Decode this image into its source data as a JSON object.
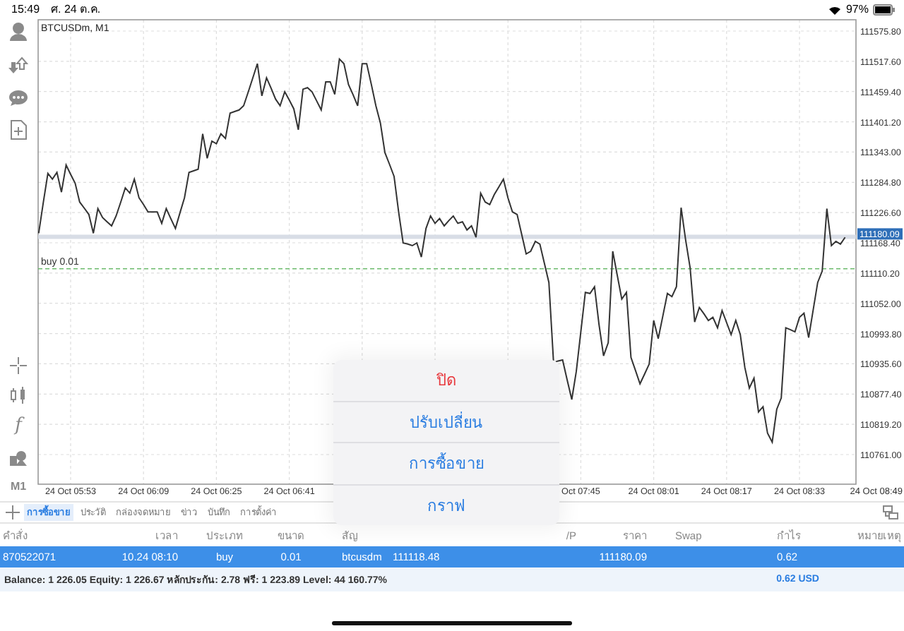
{
  "status_bar": {
    "time": "15:49",
    "date": "ศ. 24 ต.ค.",
    "battery": "97%"
  },
  "toolbar": {
    "timeframe": "M1",
    "indicator_button": "f"
  },
  "chart": {
    "title": "BTCUSDm, M1",
    "chart_data": {
      "type": "line",
      "ylim": [
        110704,
        111597.5
      ],
      "categories": [
        null,
        null,
        null,
        null,
        null,
        null,
        null,
        "24 Oct 05:53",
        null,
        null,
        null,
        null,
        null,
        null,
        null,
        null,
        null,
        null,
        null,
        null,
        null,
        null,
        null,
        "24 Oct 06:09",
        null,
        null,
        null,
        null,
        null,
        null,
        null,
        null,
        null,
        null,
        null,
        null,
        null,
        null,
        null,
        "24 Oct 06:25",
        null,
        null,
        null,
        null,
        null,
        null,
        null,
        null,
        null,
        null,
        null,
        null,
        null,
        null,
        null,
        "24 Oct 06:41",
        null,
        null,
        null,
        null,
        null,
        null,
        null,
        null,
        null,
        null,
        null,
        null,
        null,
        null,
        null,
        null,
        null,
        null,
        null,
        null,
        null,
        null,
        null,
        null,
        null,
        null,
        null,
        null,
        null,
        null,
        null,
        null,
        null,
        null,
        null,
        null,
        null,
        null,
        null,
        null,
        null,
        null,
        null,
        null,
        null,
        null,
        null,
        null,
        null,
        null,
        null,
        null,
        null,
        null,
        null,
        null,
        null,
        null,
        null,
        null,
        null,
        null,
        null,
        "Oct 07:45",
        null,
        null,
        null,
        null,
        null,
        null,
        null,
        null,
        null,
        null,
        null,
        null,
        null,
        null,
        null,
        "24 Oct 08:01",
        null,
        null,
        null,
        null,
        null,
        null,
        null,
        null,
        null,
        null,
        null,
        null,
        null,
        null,
        null,
        "24 Oct 08:17",
        null,
        null,
        null,
        null,
        null,
        null,
        null,
        null,
        null,
        null,
        null,
        null,
        null,
        null,
        null,
        "24 Oct 08:33",
        null,
        null,
        null,
        null,
        null,
        null,
        null,
        null,
        null,
        null
      ],
      "yticks": [
        {
          "value": 111575.8,
          "label": "111575.80"
        },
        {
          "value": 111517.6,
          "label": "111517.60"
        },
        {
          "value": 111459.4,
          "label": "111459.40"
        },
        {
          "value": 111401.2,
          "label": "111401.20"
        },
        {
          "value": 111343,
          "label": "111343.00"
        },
        {
          "value": 111284.8,
          "label": "111284.80"
        },
        {
          "value": 111226.6,
          "label": "111226.60"
        },
        {
          "value": 111168.4,
          "label": "111168.40"
        },
        {
          "value": 111110.2,
          "label": "111110.20"
        },
        {
          "value": 111052,
          "label": "111052.00"
        },
        {
          "value": 110993.8,
          "label": "110993.80"
        },
        {
          "value": 110935.6,
          "label": "110935.60"
        },
        {
          "value": 110877.4,
          "label": "110877.40"
        },
        {
          "value": 110819.2,
          "label": "110819.20"
        },
        {
          "value": 110761,
          "label": "110761.00"
        }
      ],
      "series": [
        {
          "color": "#333333",
          "values": [
            111187,
            111245,
            111302,
            111291,
            111304,
            111266,
            111318,
            111300,
            111283,
            111247,
            111235,
            111223,
            111187,
            111234,
            111217,
            111209,
            111201,
            111220,
            111247,
            111274,
            111264,
            111291,
            111255,
            111242,
            111228,
            111228,
            111228,
            111206,
            111234,
            111215,
            111196,
            111226,
            111255,
            111304,
            111307,
            111310,
            111378,
            111331,
            111364,
            111359,
            111378,
            111369,
            111418,
            111421,
            111424,
            111432,
            111459,
            111486,
            111513,
            111451,
            111486,
            111466,
            111445,
            111432,
            111459,
            111443,
            111426,
            111386,
            111464,
            111467,
            111459,
            111442,
            111424,
            111478,
            111478,
            111454,
            111522,
            111513,
            111473,
            111453,
            111432,
            111513,
            111513,
            111473,
            111432,
            111399,
            111342,
            111319,
            111296,
            111228,
            111168,
            111166,
            111163,
            111168,
            111141,
            111196,
            111220,
            111206,
            111215,
            111201,
            111211,
            111220,
            111206,
            111209,
            111193,
            111201,
            111179,
            111264,
            111247,
            111242,
            111261,
            111276,
            111291,
            111255,
            111228,
            111223,
            111185,
            111147,
            111152,
            111171,
            111166,
            111129,
            111092,
            110938,
            110941,
            110943,
            110905,
            110867,
            110921,
            110997,
            111073,
            111071,
            111084,
            111011,
            110951,
            110976,
            111152,
            111106,
            111060,
            111073,
            110948,
            110923,
            110897,
            110916,
            110935,
            111019,
            110984,
            111028,
            111071,
            111065,
            111084,
            111236,
            111174,
            111120,
            111016,
            111044,
            111032,
            111019,
            111025,
            111005,
            111038,
            111015,
            110992,
            111019,
            110992,
            110929,
            110889,
            110908,
            110843,
            110853,
            110802,
            110785,
            110848,
            110870,
            111005,
            111001,
            110997,
            111025,
            111033,
            110986,
            111039,
            111092,
            111114,
            111234,
            111163,
            111171,
            111166,
            111179
          ]
        }
      ],
      "grid": true,
      "ref_lines": [
        {
          "axis": "y",
          "value": 111118.48,
          "label": "buy 0.01",
          "color": "#6dbb6d"
        },
        {
          "axis": "y",
          "value": 111180.09,
          "label": "111180.09",
          "color": "#d8dde6"
        }
      ]
    },
    "axis_end_label": "24 Oct 08:49"
  },
  "action_sheet": {
    "items": [
      {
        "label": "ปิด",
        "kind": "destructive"
      },
      {
        "label": "ปรับเปลี่ยน",
        "kind": "default"
      },
      {
        "label": "การซื้อขาย",
        "kind": "default"
      },
      {
        "label": "กราฟ",
        "kind": "default"
      }
    ]
  },
  "tabs": [
    {
      "label": "การซื้อขาย",
      "selected": true
    },
    {
      "label": "ประวัติ",
      "selected": false
    },
    {
      "label": "กล่องจดหมาย",
      "selected": false
    },
    {
      "label": "ข่าว",
      "selected": false
    },
    {
      "label": "บันทึก",
      "selected": false
    },
    {
      "label": "การตั้งค่า",
      "selected": false
    }
  ],
  "table": {
    "columns": [
      "คำสั่ง",
      "เวลา",
      "ประเภท",
      "ขนาด",
      "สัญ",
      null,
      null,
      "/P",
      "ราคา",
      "Swap",
      "กำไร",
      "หมายเหตุ"
    ],
    "rows": [
      {
        "selected": true,
        "cells": [
          "870522071",
          "10.24 08:10",
          "buy",
          "0.01",
          "btcusdm",
          "111118.48",
          null,
          null,
          "111180.09",
          null,
          "0.62",
          null
        ]
      }
    ]
  },
  "summary": {
    "text": "Balance: 1 226.05 Equity: 1 226.67 หลักประกัน: 2.78 ฟรี: 1 223.89 Level: 44 160.77%",
    "profit": "0.62",
    "currency": "USD"
  }
}
